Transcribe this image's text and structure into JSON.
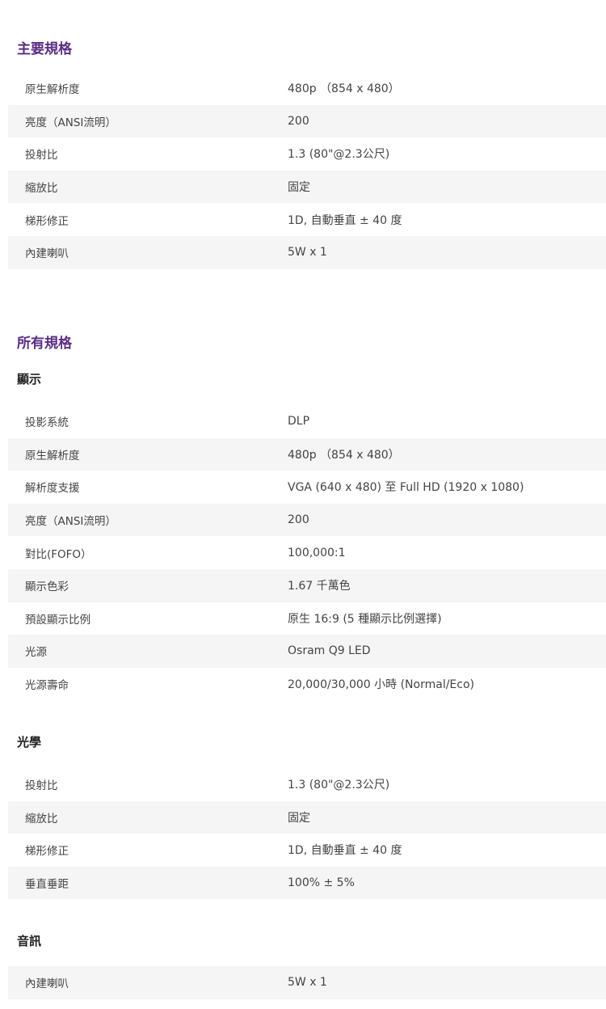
{
  "main_specs": {
    "title": "主要規格",
    "rows": [
      {
        "label": "原生解析度",
        "value": "480p （854 x 480）"
      },
      {
        "label": "亮度（ANSI流明）",
        "value": "200"
      },
      {
        "label": "投射比",
        "value": "1.3 (80\"@2.3公尺)"
      },
      {
        "label": "縮放比",
        "value": "固定"
      },
      {
        "label": "梯形修正",
        "value": "1D, 自動垂直 ± 40 度"
      },
      {
        "label": "內建喇叭",
        "value": "5W x 1"
      }
    ]
  },
  "all_specs": {
    "title": "所有規格",
    "display": {
      "title": "顯示",
      "rows": [
        {
          "label": "投影系統",
          "value": "DLP"
        },
        {
          "label": "原生解析度",
          "value": "480p （854 x 480）"
        },
        {
          "label": "解析度支援",
          "value": "VGA (640 x 480) 至 Full HD (1920 x 1080)"
        },
        {
          "label": "亮度（ANSI流明）",
          "value": "200"
        },
        {
          "label": "對比(FOFO）",
          "value": "100,000:1"
        },
        {
          "label": "顯示色彩",
          "value": "1.67 千萬色"
        },
        {
          "label": "預設顯示比例",
          "value": "原生 16:9 (5 種顯示比例選擇)"
        },
        {
          "label": "光源",
          "value": "Osram Q9 LED"
        },
        {
          "label": "光源壽命",
          "value": "20,000/30,000 小時 (Normal/Eco)"
        }
      ]
    },
    "optics": {
      "title": "光學",
      "rows": [
        {
          "label": "投射比",
          "value": "1.3 (80\"@2.3公尺)"
        },
        {
          "label": "縮放比",
          "value": "固定"
        },
        {
          "label": "梯形修正",
          "value": "1D, 自動垂直 ± 40 度"
        },
        {
          "label": "垂直垂距",
          "value": "100% ± 5%"
        }
      ]
    },
    "audio": {
      "title": "音訊",
      "rows": [
        {
          "label": "內建喇叭",
          "value": "5W x 1"
        }
      ]
    }
  }
}
